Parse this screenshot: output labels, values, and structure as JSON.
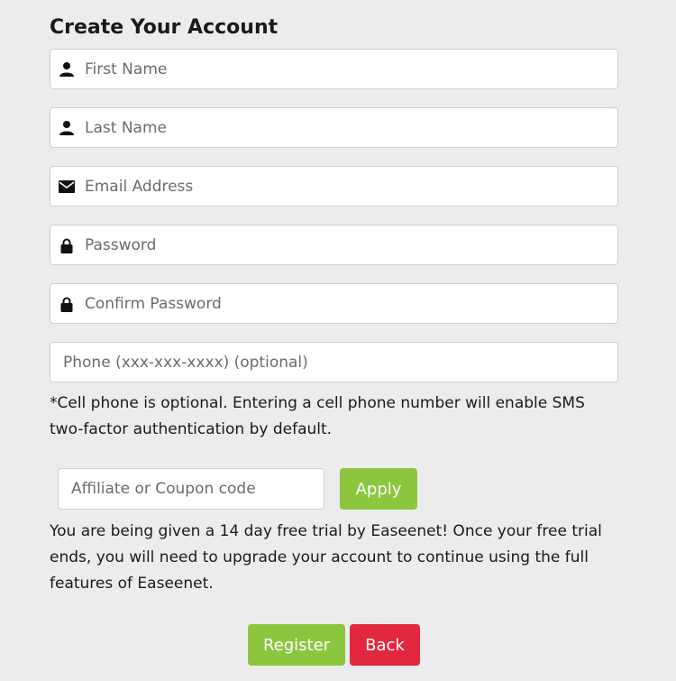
{
  "form": {
    "title": "Create Your Account",
    "fields": [
      {
        "icon": "user-icon",
        "placeholder": "First Name",
        "value": ""
      },
      {
        "icon": "user-icon",
        "placeholder": "Last Name",
        "value": ""
      },
      {
        "icon": "envelope-icon",
        "placeholder": "Email Address",
        "value": ""
      },
      {
        "icon": "lock-icon",
        "placeholder": "Password",
        "value": ""
      },
      {
        "icon": "lock-icon",
        "placeholder": "Confirm Password",
        "value": ""
      },
      {
        "icon": "",
        "placeholder": "Phone (xxx-xxx-xxxx) (optional)",
        "value": ""
      }
    ],
    "phone_note": "*Cell phone is optional. Entering a cell phone number will enable SMS two-factor authentication by default.",
    "coupon": {
      "placeholder": "Affiliate or Coupon code",
      "value": "",
      "apply_label": "Apply"
    },
    "trial_text": "You are being given a 14 day free trial by Easeenet! Once your free trial ends, you will need to upgrade your account to continue using the full features of Easeenet.",
    "register_label": "Register",
    "back_label": "Back"
  },
  "colors": {
    "background": "#ececec",
    "primary_green": "#8cc63f",
    "danger_red": "#e2283f"
  }
}
